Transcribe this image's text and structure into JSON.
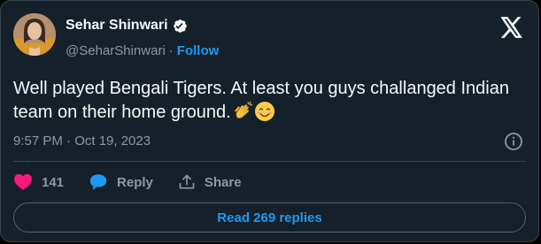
{
  "author": {
    "display_name": "Sehar Shinwari",
    "handle": "@SeharShinwari",
    "separator": "·",
    "follow_label": "Follow",
    "verified_icon": "verified-badge-icon",
    "avatar": "avatar-photo"
  },
  "tweet": {
    "text": "Well played Bengali Tigers. At least you guys challanged Indian team on their home ground.",
    "emojis": [
      "clapping-hands-emoji",
      "smiling-face-emoji"
    ],
    "time": "9:57 PM · Oct 19, 2023"
  },
  "actions": {
    "like_count": "141",
    "reply_label": "Reply",
    "share_label": "Share"
  },
  "footer": {
    "read_replies_label": "Read 269 replies"
  },
  "colors": {
    "background": "#15202b",
    "border": "#38444d",
    "text_primary": "#f7f9f9",
    "text_secondary": "#8b98a5",
    "accent": "#1d9bf0",
    "like": "#f91880"
  }
}
